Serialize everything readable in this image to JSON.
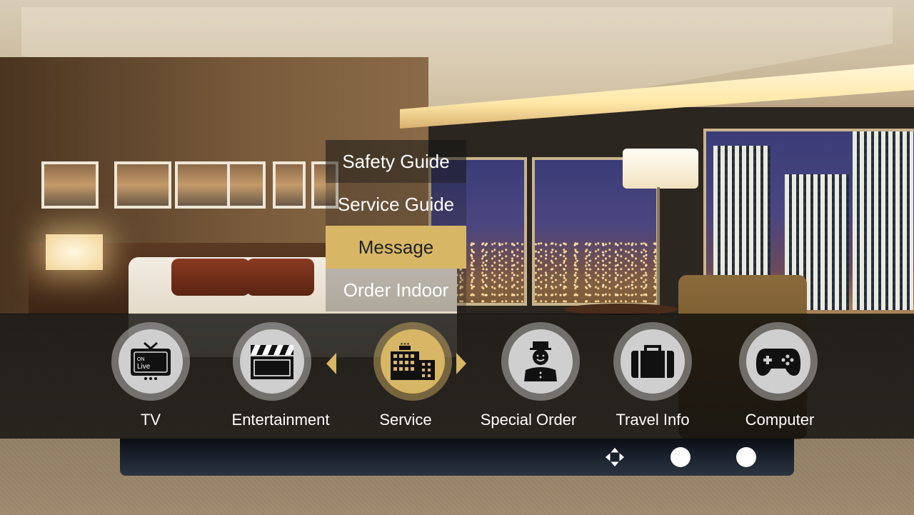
{
  "submenu": {
    "items": [
      {
        "label": "Safety Guide",
        "state": "normal"
      },
      {
        "label": "Service Guide",
        "state": "faded"
      },
      {
        "label": "Message",
        "state": "active"
      },
      {
        "label": "Order Indoor",
        "state": "faded"
      }
    ]
  },
  "menu": {
    "items": [
      {
        "label": "TV",
        "icon": "tv-icon",
        "tv_text": "ON Live"
      },
      {
        "label": "Entertainment",
        "icon": "clapperboard-icon"
      },
      {
        "label": "Service",
        "icon": "hotel-building-icon",
        "selected": true
      },
      {
        "label": "Special Order",
        "icon": "bellboy-icon"
      },
      {
        "label": "Travel Info",
        "icon": "suitcase-icon"
      },
      {
        "label": "Computer",
        "icon": "gamepad-icon"
      }
    ]
  },
  "tv_icon": {
    "line1": "ON",
    "line2": "Live"
  },
  "controls": [
    "dpad-icon",
    "button-a-icon",
    "button-b-icon"
  ],
  "colors": {
    "accent": "#d7b665",
    "bar": "#0a0a0a",
    "icon_bg": "#cfcfcf",
    "text": "#ffffff"
  }
}
